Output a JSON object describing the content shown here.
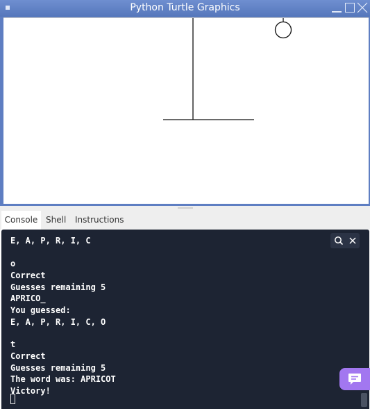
{
  "window": {
    "title": "Python Turtle Graphics"
  },
  "tabs": [
    {
      "label": "Console",
      "active": true
    },
    {
      "label": "Shell",
      "active": false
    },
    {
      "label": "Instructions",
      "active": false
    }
  ],
  "console": {
    "lines": [
      "E, A, P, R, I, C",
      "",
      "o",
      "Correct",
      "Guesses remaining 5",
      "APRICO_",
      "You guessed:",
      "E, A, P, R, I, C, O",
      "",
      "t",
      "Correct",
      "Guesses remaining 5",
      "The word was: APRICOT",
      "Victory!"
    ]
  },
  "icons": {
    "search": "search-icon",
    "close": "close-icon",
    "chat": "chat-icon",
    "app": "turtle-app-icon"
  },
  "colors": {
    "titlebar": "#5e7ec2",
    "console_background": "#1d2433",
    "console_text": "#ffffff",
    "chat_button": "#a277f0"
  }
}
